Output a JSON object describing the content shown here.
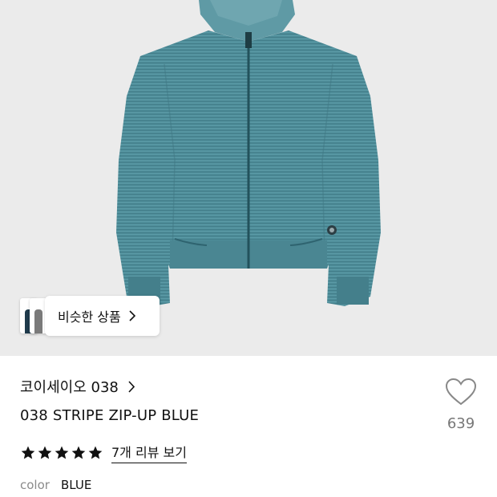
{
  "similar_products": {
    "label": "비슷한 상품"
  },
  "product": {
    "brand": "코이세이오 038",
    "name": "038 STRIPE ZIP-UP BLUE",
    "rating": 5,
    "review_link": "7개 리뷰 보기",
    "color_label": "color",
    "color_value": "BLUE",
    "like_count": "639"
  },
  "colors": {
    "hero_bg": "#ebebeb",
    "hoodie": "#4e8d99",
    "star": "#111111"
  },
  "icons": {
    "chevron": "chevron-right-icon",
    "heart": "heart-outline-icon",
    "star": "star-filled-icon"
  }
}
